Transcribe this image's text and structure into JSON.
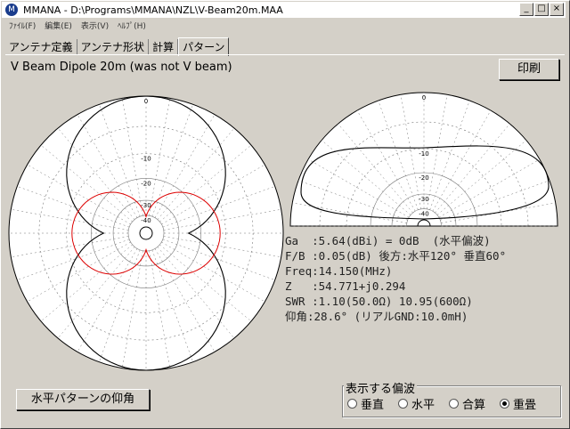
{
  "window": {
    "title": "MMANA - D:\\Programs\\MMANA\\NZL\\V-Beam20m.MAA",
    "controls": [
      "_",
      "□",
      "×"
    ]
  },
  "menu": [
    {
      "label": "ﾌｧｲﾙ(F)"
    },
    {
      "label": "編集(E)"
    },
    {
      "label": "表示(V)"
    },
    {
      "label": "ﾍﾙﾌﾟ(H)"
    }
  ],
  "tabs": [
    {
      "label": "アンテナ定義"
    },
    {
      "label": "アンテナ形状"
    },
    {
      "label": "計算"
    },
    {
      "label": "パターン"
    }
  ],
  "model_title": "V Beam Dipole  20m (was not V beam)",
  "print_label": "印刷",
  "horizontal_plot": {
    "ticks": [
      "0",
      "-10",
      "-20",
      "-30",
      "-40"
    ],
    "colors": {
      "grid": "#777777",
      "total": "#000000",
      "red": "#dd0000"
    }
  },
  "vertical_plot": {
    "ticks": [
      "0",
      "-10",
      "-20",
      "-30",
      "-40"
    ]
  },
  "results": {
    "ga": "Ga  :5.64(dBi) = 0dB  (水平偏波)",
    "fb": "F/B :0.05(dB) 後方:水平120° 垂直60°",
    "freq": "Freq:14.150(MHz)",
    "z": "Z   :54.771+j0.294",
    "swr": "SWR :1.10(50.0Ω) 10.95(600Ω)",
    "elev": "仰角:28.6° (リアルGND:10.0mH)"
  },
  "elevation_button": "水平パターンの仰角",
  "polarization": {
    "legend": "表示する偏波",
    "options": [
      {
        "label": "垂直",
        "selected": false
      },
      {
        "label": "水平",
        "selected": false
      },
      {
        "label": "合算",
        "selected": false
      },
      {
        "label": "重畳",
        "selected": true
      }
    ]
  }
}
